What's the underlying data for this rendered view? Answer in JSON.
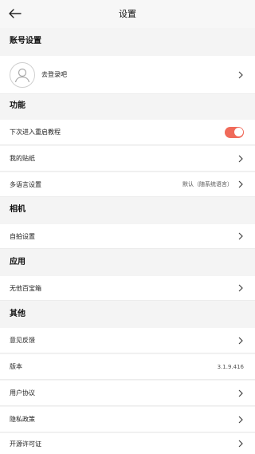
{
  "header": {
    "title": "设置",
    "back_icon": "arrow-left-icon"
  },
  "account": {
    "section_title": "账号设置",
    "login_label": "去登录吧"
  },
  "functions": {
    "section_title": "功能",
    "tutorial_label": "下次进入重启教程",
    "tutorial_enabled": true,
    "stickers_label": "我的贴纸",
    "language_label": "多语言设置",
    "language_value": "默认（随系统语言）"
  },
  "camera": {
    "section_title": "相机",
    "selfie_label": "自拍设置"
  },
  "apps": {
    "section_title": "应用",
    "toolbox_label": "无他百宝箱"
  },
  "other": {
    "section_title": "其他",
    "feedback_label": "意见反馈",
    "version_label": "版本",
    "version_value": "3.1.9.416",
    "agreement_label": "用户协议",
    "privacy_label": "隐私政策",
    "license_label": "开源许可证"
  },
  "colors": {
    "accent": "#f06a5a",
    "background": "#f4f4f4",
    "row": "#ffffff"
  }
}
